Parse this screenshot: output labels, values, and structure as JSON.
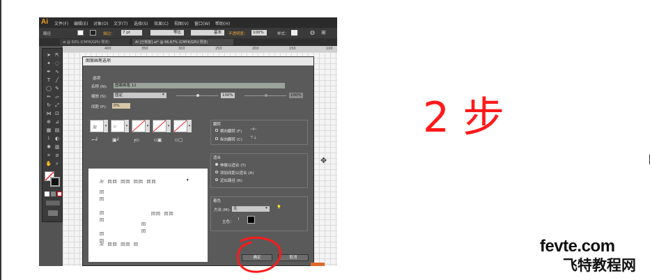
{
  "menubar": {
    "logo": "Ai",
    "items": [
      "文件(F)",
      "编辑(E)",
      "对象(O)",
      "文字(T)",
      "选择(S)",
      "效果(C)",
      "视图(V)",
      "窗口(W)",
      "帮助(H)"
    ]
  },
  "control_bar": {
    "object_label": "路径",
    "stroke_label": "描边：",
    "stroke_weight": "7 pt",
    "profile_label": "等比",
    "brush_label": "基本",
    "opacity_label": "不透明度：",
    "opacity_value": "100%",
    "style_label": "样式："
  },
  "doc_tabs": [
    {
      "label": "ai @ 50% (CMYK/GPU 预览)"
    },
    {
      "label": "AI [已恢复].ai* @ 66.67% (CMYK/GPU 预览)"
    }
  ],
  "ruler_ticks": [
    "400",
    "350",
    "300",
    "250",
    "200",
    "150",
    "100"
  ],
  "dialog": {
    "title": "图案画笔选项",
    "options_section": "选项",
    "name_label": "名称 (N):",
    "name_value": "图案画笔 12",
    "scale_label": "缩放 (S):",
    "scale_value": "固定",
    "scale_pct_1": "100%",
    "scale_pct_2": "100%",
    "spacing_label": "间距 (P):",
    "spacing_value": "0%",
    "flip_section": "翻转",
    "flip_h": "横向翻转 (F)",
    "flip_v": "纵向翻转 (C)",
    "fit_section": "适合",
    "fit_stretch": "伸展以适合 (T)",
    "fit_add_space": "添加间距以适合 (A)",
    "fit_approx": "近似路径 (R)",
    "color_section": "着色",
    "method_label": "方法 (M):",
    "method_value": "无",
    "key_color_label": "主色：",
    "ok_label": "确定",
    "cancel_label": "取消"
  },
  "annotation": {
    "step_text": "2 步",
    "circle_color": "#ff1a1a"
  },
  "watermark": {
    "line1": "fevte.com",
    "line2": "飞特教程网"
  },
  "colors": {
    "ui_dark": "#535353",
    "accent_red": "#ff1a1a",
    "ai_orange": "#f7a21b"
  }
}
